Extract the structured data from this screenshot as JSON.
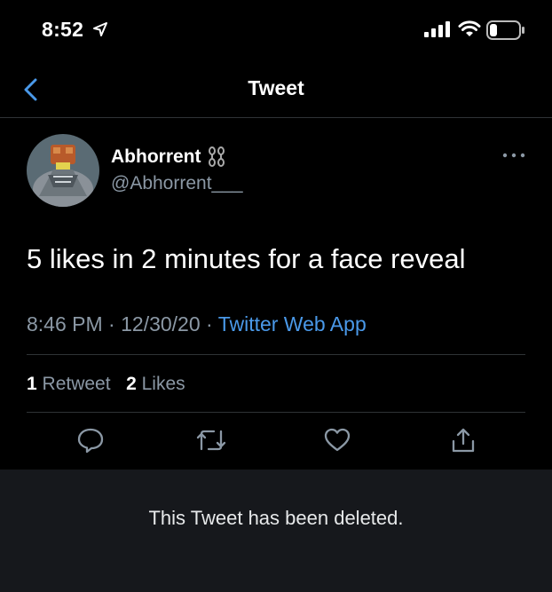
{
  "status_bar": {
    "time": "8:52",
    "icons": [
      "location-arrow-icon",
      "signal-icon",
      "wifi-icon",
      "battery-icon"
    ]
  },
  "nav": {
    "title": "Tweet",
    "back_icon": "chevron-left-icon"
  },
  "tweet": {
    "author_name": "Abhorrent",
    "author_name_emoji": "chains",
    "handle": "@Abhorrent___",
    "text": "5 likes in 2 minutes for a face reveal",
    "time": "8:46 PM",
    "date": "12/30/20",
    "separator": "·",
    "source": "Twitter Web App",
    "retweet_count": "1",
    "retweet_label": "Retweet",
    "like_count": "2",
    "like_label": "Likes",
    "actions": [
      "reply-icon",
      "retweet-icon",
      "like-icon",
      "share-icon"
    ]
  },
  "deleted_notice": "This Tweet has been deleted.",
  "colors": {
    "background": "#000000",
    "accent": "#4a99e9",
    "muted": "#8b98a5",
    "divider": "#2f3336",
    "notice_bg": "#16181c"
  }
}
